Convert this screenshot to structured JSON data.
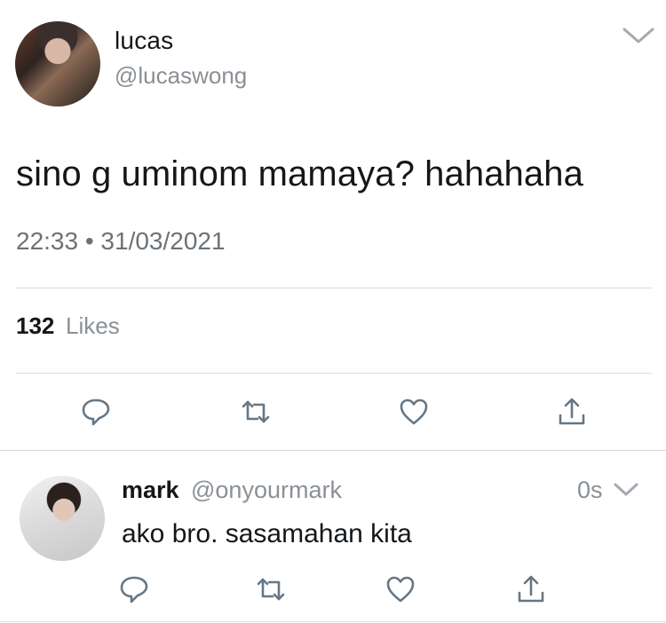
{
  "tweet": {
    "author_name": "lucas",
    "author_handle": "@lucaswong",
    "text": "sino g uminom mamaya? hahahaha",
    "timestamp": "22:33 • 31/03/2021",
    "likes_count": "132",
    "likes_label": "Likes",
    "icons": [
      "reply-icon",
      "retweet-icon",
      "like-icon",
      "share-icon"
    ]
  },
  "reply": {
    "author_name": "mark",
    "author_handle": "@onyourmark",
    "time": "0s",
    "text": "ako bro. sasamahan kita",
    "icons": [
      "reply-icon",
      "retweet-icon",
      "like-icon",
      "share-icon"
    ]
  },
  "colors": {
    "text_primary": "#14171a",
    "text_secondary": "#8a9096",
    "divider": "#d7dadc",
    "icon_stroke": "#657786"
  }
}
